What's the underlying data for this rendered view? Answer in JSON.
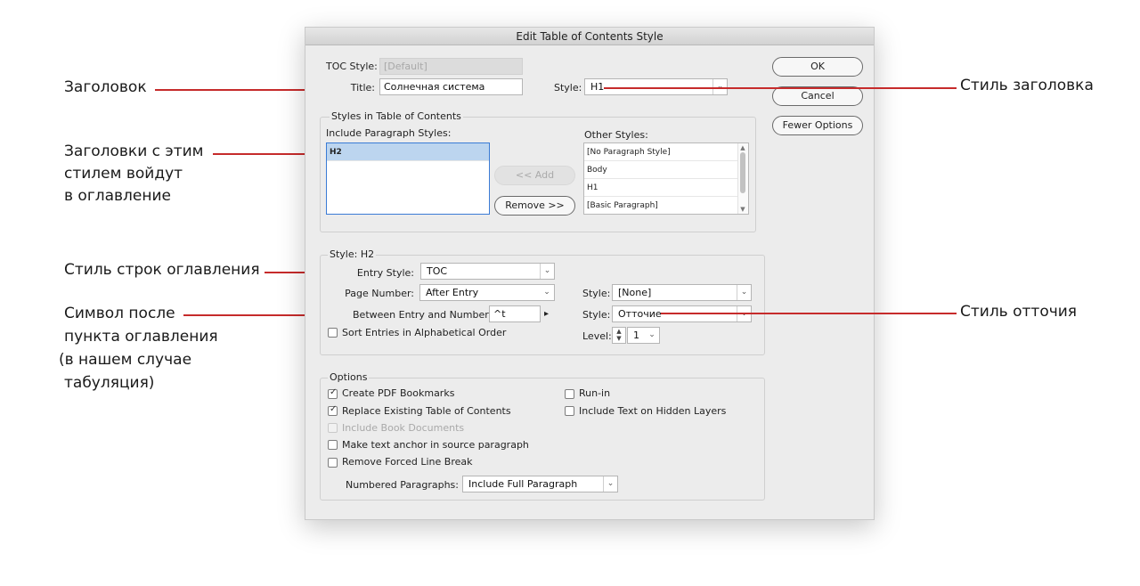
{
  "annotations": {
    "title": "Заголовок",
    "paragraph_styles": [
      "Заголовки с этим",
      "стилем войдут",
      "в оглавление"
    ],
    "entry_style": "Стиль строк оглавления",
    "between": [
      "Символ после",
      "пункта оглавления",
      "(в нашем случае",
      "табуляция)"
    ],
    "title_style": "Стиль заголовка",
    "leader_style": "Стиль отточия"
  },
  "dialog": {
    "window_title": "Edit Table of Contents Style",
    "toc_style": {
      "label": "TOC Style:",
      "value": "[Default]"
    },
    "title": {
      "label": "Title:",
      "value": "Солнечная система"
    },
    "title_style": {
      "label": "Style:",
      "value": "H1"
    },
    "buttons": {
      "ok": "OK",
      "cancel": "Cancel",
      "fewer_options": "Fewer Options"
    },
    "styles_in_toc": {
      "group_label": "Styles in Table of Contents",
      "include_label": "Include Paragraph Styles:",
      "include_items": [
        "H2"
      ],
      "other_label": "Other Styles:",
      "other_items": [
        "[No Paragraph Style]",
        "Body",
        "H1",
        "[Basic Paragraph]"
      ],
      "add_button": "<< Add",
      "remove_button": "Remove >>"
    },
    "style_h2": {
      "group_label": "Style: H2",
      "entry_style": {
        "label": "Entry Style:",
        "value": "TOC"
      },
      "page_number": {
        "label": "Page Number:",
        "value": "After Entry"
      },
      "page_number_style": {
        "label": "Style:",
        "value": "[None]"
      },
      "between": {
        "label": "Between Entry and Number:",
        "value": "^t",
        "arrow": "▸"
      },
      "between_style": {
        "label": "Style:",
        "value": "Отточие"
      },
      "sort": {
        "label": "Sort Entries in Alphabetical Order",
        "checked": false
      },
      "level": {
        "label": "Level:",
        "value": "1"
      }
    },
    "options": {
      "group_label": "Options",
      "create_pdf_bookmarks": {
        "label": "Create PDF Bookmarks",
        "checked": true
      },
      "replace_existing": {
        "label": "Replace Existing Table of Contents",
        "checked": true
      },
      "include_book_documents": {
        "label": "Include Book Documents",
        "checked": false,
        "disabled": true
      },
      "make_text_anchor": {
        "label": "Make text anchor in source paragraph",
        "checked": false
      },
      "remove_forced_line_break": {
        "label": "Remove Forced Line Break",
        "checked": false
      },
      "run_in": {
        "label": "Run-in",
        "checked": false
      },
      "include_hidden_layers": {
        "label": "Include Text on Hidden Layers",
        "checked": false
      },
      "numbered_paragraphs": {
        "label": "Numbered Paragraphs:",
        "value": "Include Full Paragraph"
      }
    }
  },
  "colors": {
    "leader": "#c62b2b",
    "selection": "#bcd5ef",
    "focus": "#3a7bd5"
  },
  "icons": {
    "chevron": "chevron-down-icon",
    "checkmark": "checkmark-icon",
    "stepper": "stepper-icon"
  }
}
